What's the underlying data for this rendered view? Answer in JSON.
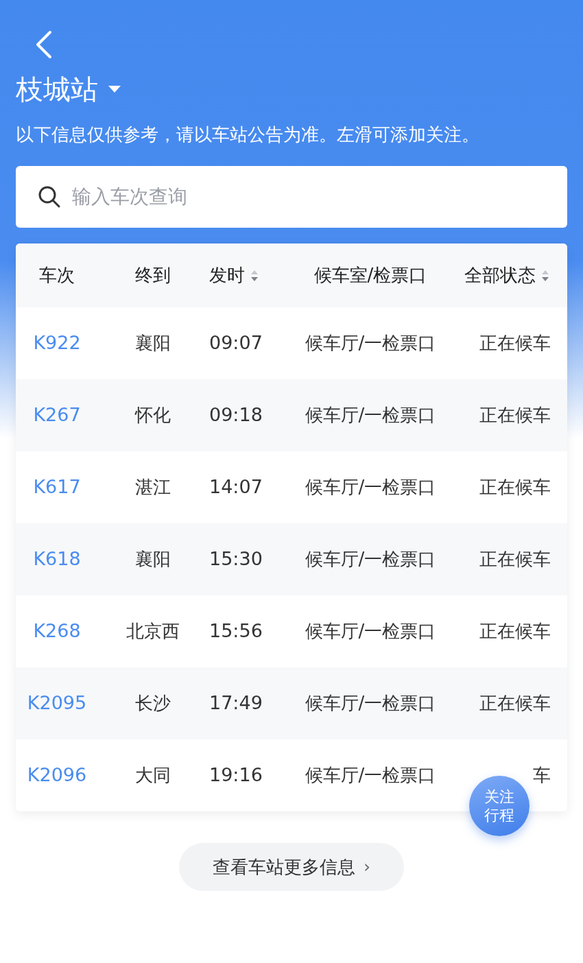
{
  "header": {
    "station": "枝城站",
    "notice": "以下信息仅供参考，请以车站公告为准。左滑可添加关注。"
  },
  "search": {
    "placeholder": "输入车次查询"
  },
  "table": {
    "columns": [
      {
        "label": "车次",
        "sortable": false
      },
      {
        "label": "终到",
        "sortable": false
      },
      {
        "label": "发时",
        "sortable": true
      },
      {
        "label": "候车室/检票口",
        "sortable": false
      },
      {
        "label": "全部状态",
        "sortable": true
      }
    ],
    "rows": [
      {
        "train": "K922",
        "destination": "襄阳",
        "departs": "09:07",
        "gate": "候车厅/一检票口",
        "status": "正在候车"
      },
      {
        "train": "K267",
        "destination": "怀化",
        "departs": "09:18",
        "gate": "候车厅/一检票口",
        "status": "正在候车"
      },
      {
        "train": "K617",
        "destination": "湛江",
        "departs": "14:07",
        "gate": "候车厅/一检票口",
        "status": "正在候车"
      },
      {
        "train": "K618",
        "destination": "襄阳",
        "departs": "15:30",
        "gate": "候车厅/一检票口",
        "status": "正在候车"
      },
      {
        "train": "K268",
        "destination": "北京西",
        "departs": "15:56",
        "gate": "候车厅/一检票口",
        "status": "正在候车"
      },
      {
        "train": "K2095",
        "destination": "长沙",
        "departs": "17:49",
        "gate": "候车厅/一检票口",
        "status": "正在候车"
      },
      {
        "train": "K2096",
        "destination": "大同",
        "departs": "19:16",
        "gate": "候车厅/一检票口",
        "status": "车"
      }
    ]
  },
  "follow_button": {
    "lines": [
      "关注",
      "行程"
    ]
  },
  "more_button": {
    "label": "查看车站更多信息",
    "arrow": "›"
  }
}
